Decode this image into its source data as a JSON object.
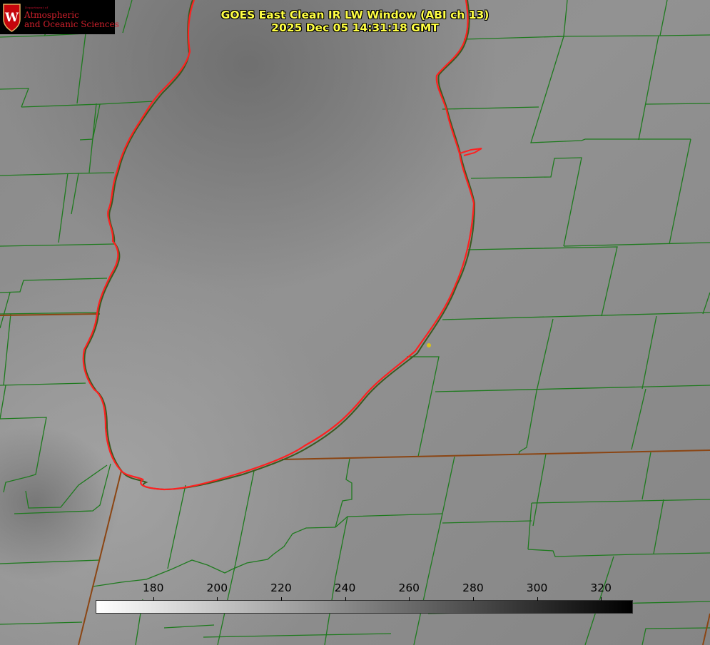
{
  "logo": {
    "department": "Department of",
    "line1": "Atmospheric",
    "line2": "and Oceanic Sciences",
    "crest_letter": "W",
    "crest_color": "#c5050c"
  },
  "title": {
    "line1": "GOES East Clean IR LW Window (ABI ch 13)",
    "line2": "2025 Dec 05 14:31:18 GMT",
    "color": "#ffff44"
  },
  "colorbar": {
    "min": 162,
    "max": 330,
    "ticks": [
      180,
      200,
      220,
      240,
      260,
      280,
      300,
      320
    ],
    "gradient_from": "#ffffff",
    "gradient_to": "#000000"
  },
  "map": {
    "feature": "lake-outline",
    "lake_outline_color": "#ff2020",
    "county_line_color": "#1e7a1e",
    "state_line_color": "#8b4513",
    "marker_color": "#d8c21a"
  }
}
